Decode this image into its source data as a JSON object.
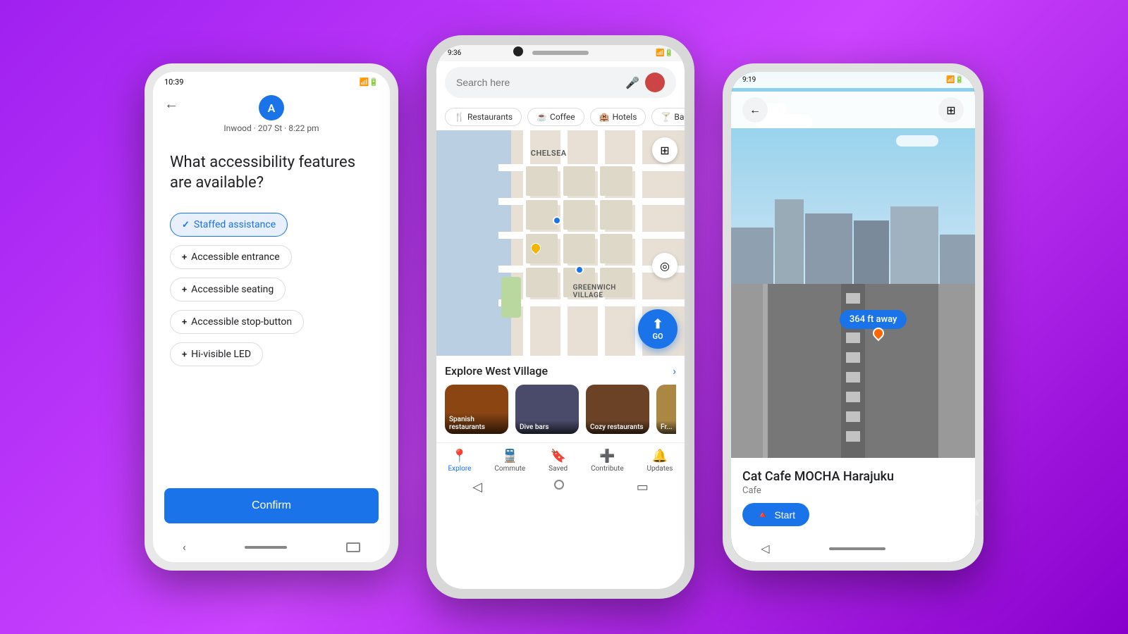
{
  "background": {
    "gradient_start": "#a020f0",
    "gradient_end": "#8800cc"
  },
  "phone1": {
    "statusbar": {
      "time": "10:39",
      "icons": "⚡📶🔋"
    },
    "header": {
      "avatar_letter": "A",
      "route_info": "Inwood · 207 St · 8:22 pm"
    },
    "question": "What accessibility features are available?",
    "chips": [
      {
        "label": "Staffed assistance",
        "selected": true,
        "icon": "✓"
      },
      {
        "label": "Accessible entrance",
        "selected": false,
        "icon": "+"
      },
      {
        "label": "Accessible seating",
        "selected": false,
        "icon": "+"
      },
      {
        "label": "Accessible stop-button",
        "selected": false,
        "icon": "+"
      },
      {
        "label": "Hi-visible LED",
        "selected": false,
        "icon": "+"
      }
    ],
    "confirm_label": "Confirm"
  },
  "phone2": {
    "statusbar": {
      "time": "9:36"
    },
    "search_placeholder": "Search here",
    "chips": [
      {
        "label": "Restaurants",
        "icon": "🍴"
      },
      {
        "label": "Coffee",
        "icon": "☕"
      },
      {
        "label": "Hotels",
        "icon": "🏨"
      },
      {
        "label": "Bars",
        "icon": "🍸"
      }
    ],
    "map": {
      "location_label": "CHELSEA",
      "location_label2": "GREENWICH VILLAGE"
    },
    "explore": {
      "title": "Explore West Village",
      "cards": [
        {
          "label": "Spanish restaurants",
          "color": "#8B4513"
        },
        {
          "label": "Dive bars",
          "color": "#4a4a6a"
        },
        {
          "label": "Cozy restaurants",
          "color": "#6B4226"
        },
        {
          "label": "Fr...",
          "color": "#aa8844"
        }
      ]
    },
    "bottomnav": [
      {
        "label": "Explore",
        "icon": "📍",
        "active": true
      },
      {
        "label": "Commute",
        "icon": "🚆",
        "active": false
      },
      {
        "label": "Saved",
        "icon": "🔖",
        "active": false
      },
      {
        "label": "Contribute",
        "icon": "➕",
        "active": false
      },
      {
        "label": "Updates",
        "icon": "🔔",
        "active": false
      }
    ],
    "go_label": "GO"
  },
  "phone3": {
    "statusbar": {
      "time": "9:19"
    },
    "distance_badge": "364 ft away",
    "place": {
      "name": "Cat Cafe MOCHA Harajuku",
      "type": "Cafe"
    },
    "start_label": "Start"
  }
}
